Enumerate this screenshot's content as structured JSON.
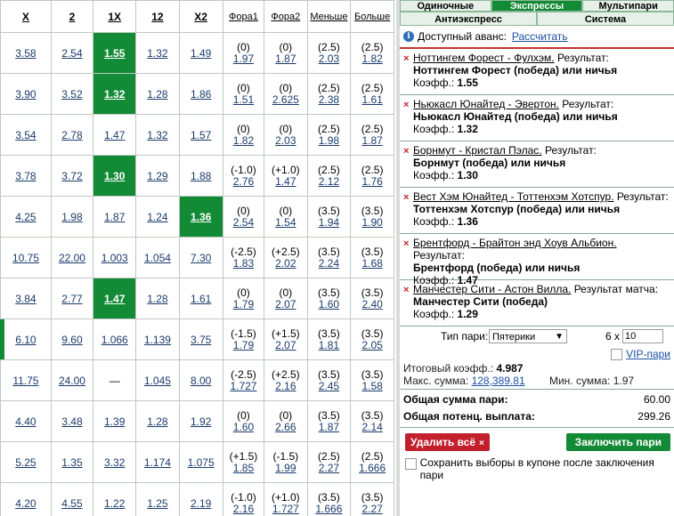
{
  "table": {
    "headers": [
      "X",
      "2",
      "1X",
      "12",
      "X2",
      "Фора1",
      "Фора2",
      "Меньше",
      "Больше"
    ],
    "rows": [
      {
        "x": "3.58",
        "two": "2.54",
        "onex": "1.55",
        "onetwo": "1.32",
        "x2": "1.49",
        "f1h": "(0)",
        "f1": "1.97",
        "f2h": "(0)",
        "f2": "1.87",
        "mh": "(2.5)",
        "m": "2.03",
        "bh": "(2.5)",
        "b": "1.82"
      },
      {
        "x": "3.90",
        "two": "3.52",
        "onex": "1.32",
        "onetwo": "1.28",
        "x2": "1.86",
        "f1h": "(0)",
        "f1": "1.51",
        "f2h": "(0)",
        "f2": "2.625",
        "mh": "(2.5)",
        "m": "2.38",
        "bh": "(2.5)",
        "b": "1.61"
      },
      {
        "x": "3.54",
        "two": "2.78",
        "onex": "1.47",
        "onetwo": "1.32",
        "x2": "1.57",
        "f1h": "(0)",
        "f1": "1.82",
        "f2h": "(0)",
        "f2": "2.03",
        "mh": "(2.5)",
        "m": "1.98",
        "bh": "(2.5)",
        "b": "1.87"
      },
      {
        "x": "3.78",
        "two": "3.72",
        "onex": "1.30",
        "onetwo": "1.29",
        "x2": "1.88",
        "f1h": "(-1.0)",
        "f1": "2.76",
        "f2h": "(+1.0)",
        "f2": "1.47",
        "mh": "(2.5)",
        "m": "2.12",
        "bh": "(2.5)",
        "b": "1.76"
      },
      {
        "x": "4.25",
        "two": "1.98",
        "onex": "1.87",
        "onetwo": "1.24",
        "x2": "1.36",
        "f1h": "(0)",
        "f1": "2.54",
        "f2h": "(0)",
        "f2": "1.54",
        "mh": "(3.5)",
        "m": "1.94",
        "bh": "(3.5)",
        "b": "1.90"
      },
      {
        "x": "10.75",
        "two": "22.00",
        "onex": "1.003",
        "onetwo": "1.054",
        "x2": "7.30",
        "f1h": "(-2.5)",
        "f1": "1.83",
        "f2h": "(+2.5)",
        "f2": "2.02",
        "mh": "(3.5)",
        "m": "2.24",
        "bh": "(3.5)",
        "b": "1.68"
      },
      {
        "x": "3.84",
        "two": "2.77",
        "onex": "1.47",
        "onetwo": "1.28",
        "x2": "1.61",
        "f1h": "(0)",
        "f1": "1.79",
        "f2h": "(0)",
        "f2": "2.07",
        "mh": "(3.5)",
        "m": "1.60",
        "bh": "(3.5)",
        "b": "2.40"
      },
      {
        "x": "6.10",
        "two": "9.60",
        "onex": "1.066",
        "onetwo": "1.139",
        "x2": "3.75",
        "f1h": "(-1.5)",
        "f1": "1.79",
        "f2h": "(+1.5)",
        "f2": "2.07",
        "mh": "(3.5)",
        "m": "1.81",
        "bh": "(3.5)",
        "b": "2.05"
      },
      {
        "x": "11.75",
        "two": "24.00",
        "onex": "—",
        "onetwo": "1.045",
        "x2": "8.00",
        "f1h": "(-2.5)",
        "f1": "1.727",
        "f2h": "(+2.5)",
        "f2": "2.16",
        "mh": "(3.5)",
        "m": "2.45",
        "bh": "(3.5)",
        "b": "1.58"
      },
      {
        "x": "4.40",
        "two": "3.48",
        "onex": "1.39",
        "onetwo": "1.28",
        "x2": "1.92",
        "f1h": "(0)",
        "f1": "1.60",
        "f2h": "(0)",
        "f2": "2.66",
        "mh": "(3.5)",
        "m": "1.87",
        "bh": "(3.5)",
        "b": "2.14"
      },
      {
        "x": "5.25",
        "two": "1.35",
        "onex": "3.32",
        "onetwo": "1.174",
        "x2": "1.075",
        "f1h": "(+1.5)",
        "f1": "1.85",
        "f2h": "(-1.5)",
        "f2": "1.99",
        "mh": "(2.5)",
        "m": "2.27",
        "bh": "(2.5)",
        "b": "1.666"
      },
      {
        "x": "4.20",
        "two": "4.55",
        "onex": "1.22",
        "onetwo": "1.25",
        "x2": "2.19",
        "f1h": "(-1.0)",
        "f1": "2.16",
        "f2h": "(+1.0)",
        "f2": "1.727",
        "mh": "(3.5)",
        "m": "1.666",
        "bh": "(3.5)",
        "b": "2.27"
      }
    ]
  },
  "coupon": {
    "tabs": [
      "Одиночные",
      "Экспрессы",
      "Мультипари"
    ],
    "tabs2": [
      "Антиэкспресс",
      "Система"
    ],
    "avans_label": "Доступный аванс:",
    "avans_link": "Рассчитать",
    "bets": [
      {
        "match": "Ноттингем Форест - Фулхэм.",
        "type": "Результат:",
        "result": "Ноттингем Форест (победа) или ничья",
        "coef_label": "Коэфф.:",
        "coef": "1.55"
      },
      {
        "match": "Ньюкасл Юнайтед - Эвертон.",
        "type": "Результат:",
        "result": "Ньюкасл Юнайтед (победа) или ничья",
        "coef_label": "Коэфф.:",
        "coef": "1.32"
      },
      {
        "match": "Борнмут - Кристал Пэлас.",
        "type": "Результат:",
        "result": "Борнмут (победа) или ничья",
        "coef_label": "Коэфф.:",
        "coef": "1.30"
      },
      {
        "match": "Вест Хэм Юнайтед - Тоттенхэм Хотспур.",
        "type": "Результат:",
        "result": "Тоттенхэм Хотспур (победа) или ничья",
        "coef_label": "Коэфф.:",
        "coef": "1.36"
      },
      {
        "match": "Брентфорд - Брайтон энд Хоув Альбион.",
        "type": "Результат:",
        "result": "Брентфорд (победа) или ничья",
        "coef_label": "Коэфф.:",
        "coef": "1.47"
      },
      {
        "match": "Манчестер Сити - Астон Вилла.",
        "type": "Результат матча:",
        "result": "Манчестер Сити (победа)",
        "coef_label": "Коэфф.:",
        "coef": "1.29"
      }
    ],
    "bet_type_label": "Тип пари:",
    "bet_type_value": "Пятерики",
    "mult_label": "6 x",
    "mult_value": "10",
    "vip_label": "VIP-пари",
    "total_coef_label": "Итоговый коэфф.:",
    "total_coef": "4.987",
    "max_sum_label": "Макс. сумма:",
    "max_sum": "128,389.81",
    "min_sum_label": "Мин. сумма:",
    "min_sum": "1.97",
    "total_sum_label": "Общая сумма пари:",
    "total_sum": "60.00",
    "potential_label": "Общая потенц. выплата:",
    "potential": "299.26",
    "delete_all": "Удалить всё",
    "delete_x": "×",
    "conclude": "Заключить пари",
    "keep_label": "Сохранить выборы в купоне после заключения пари"
  }
}
